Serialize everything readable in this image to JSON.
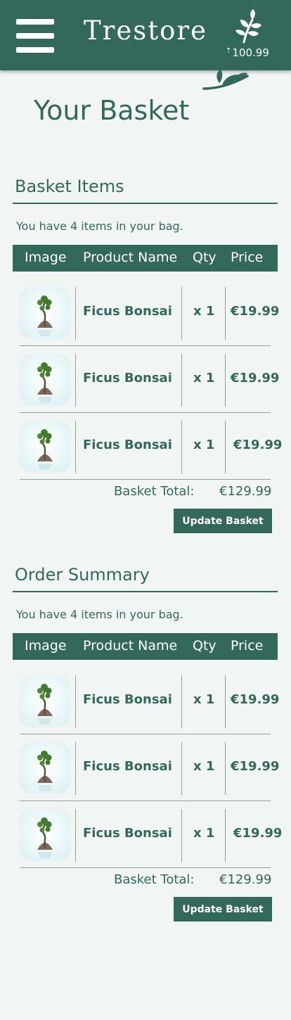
{
  "header": {
    "brand": "Trestore",
    "points": "100.99",
    "points_prefix": "⇡"
  },
  "page": {
    "title": "Your Basket"
  },
  "colors": {
    "primary": "#33695a",
    "background": "#f1f6f5"
  },
  "basket": {
    "title": "Basket Items",
    "count_text": "You have 4 items in your bag.",
    "columns": [
      "Image",
      "Product Name",
      "Qty",
      "Price"
    ],
    "items": [
      {
        "name": "Ficus Bonsai",
        "qty": "x 1",
        "price": "€19.99",
        "image": "bonsai-image"
      },
      {
        "name": "Ficus Bonsai",
        "qty": "x 1",
        "price": "€19.99",
        "image": "bonsai-image"
      },
      {
        "name": "Ficus Bonsai",
        "qty": "x 1",
        "price": "€19.99",
        "image": "bonsai-image"
      }
    ],
    "total_label": "Basket Total:",
    "total_value": "€129.99",
    "button_label": "Update Basket"
  },
  "summary": {
    "title": "Order Summary",
    "count_text": "You have 4 items in your bag.",
    "columns": [
      "Image",
      "Product Name",
      "Qty",
      "Price"
    ],
    "items": [
      {
        "name": "Ficus Bonsai",
        "qty": "x 1",
        "price": "€19.99",
        "image": "bonsai-image"
      },
      {
        "name": "Ficus Bonsai",
        "qty": "x 1",
        "price": "€19.99",
        "image": "bonsai-image"
      },
      {
        "name": "Ficus Bonsai",
        "qty": "x 1",
        "price": "€19.99",
        "image": "bonsai-image"
      }
    ],
    "total_label": "Basket Total:",
    "total_value": "€129.99",
    "button_label": "Update Basket"
  },
  "icons": {
    "menu": "hamburger-menu-icon",
    "points": "leaf-icon",
    "decoration": "branch-icon"
  }
}
